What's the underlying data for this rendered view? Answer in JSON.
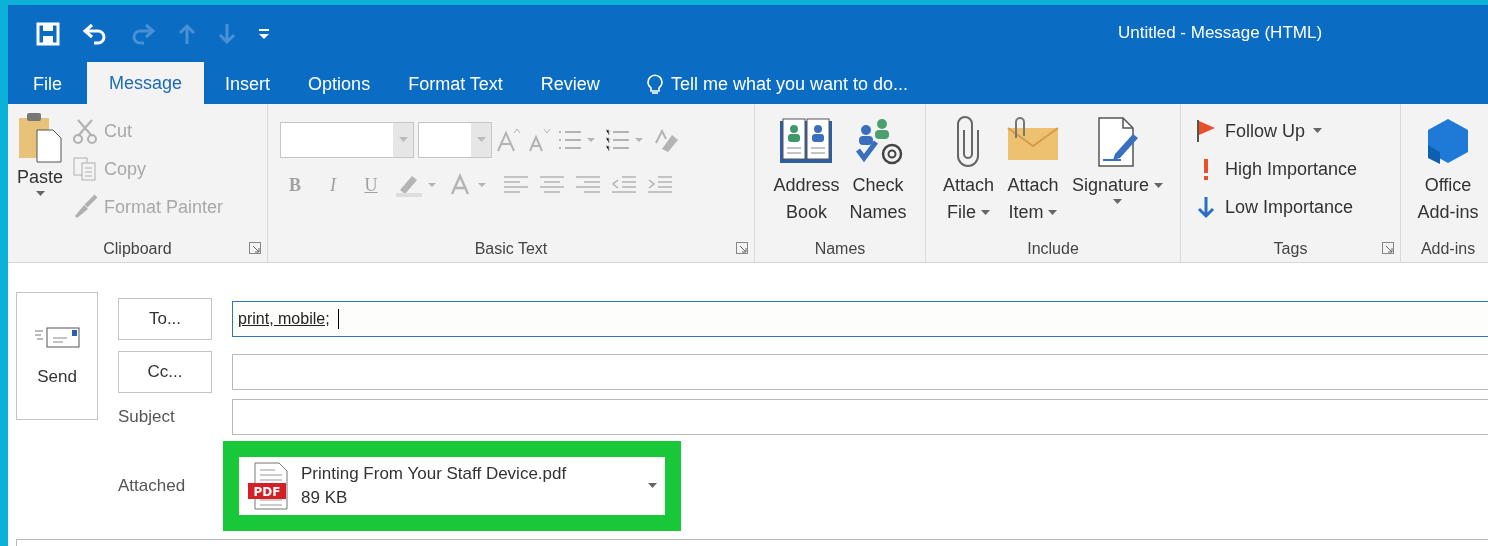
{
  "window": {
    "title": "Untitled - Message (HTML)"
  },
  "quick_access": [
    {
      "kind": "save",
      "disabled": false
    },
    {
      "kind": "undo",
      "disabled": false
    },
    {
      "kind": "redo",
      "disabled": true
    },
    {
      "kind": "up",
      "disabled": true
    },
    {
      "kind": "down",
      "disabled": true
    },
    {
      "kind": "customize",
      "disabled": false
    }
  ],
  "tabs": [
    {
      "label": "File",
      "selected": false
    },
    {
      "label": "Message",
      "selected": true
    },
    {
      "label": "Insert",
      "selected": false
    },
    {
      "label": "Options",
      "selected": false
    },
    {
      "label": "Format Text",
      "selected": false
    },
    {
      "label": "Review",
      "selected": false
    }
  ],
  "tell_me": "Tell me what you want to do...",
  "ribbon": {
    "clipboard": {
      "label": "Clipboard",
      "paste": "Paste",
      "items": [
        {
          "kind": "cut",
          "label": "Cut",
          "disabled": true
        },
        {
          "kind": "copy",
          "label": "Copy",
          "disabled": true
        },
        {
          "kind": "painter",
          "label": "Format Painter",
          "disabled": true
        }
      ]
    },
    "basic_text": {
      "label": "Basic Text",
      "disabled": true,
      "style_buttons": [
        "B",
        "I",
        "U"
      ]
    },
    "names": {
      "label": "Names",
      "buttons": [
        {
          "kind": "book",
          "lines": [
            "Address",
            "Book"
          ],
          "dropdown": false
        },
        {
          "kind": "check",
          "lines": [
            "Check",
            "Names"
          ],
          "dropdown": false
        }
      ]
    },
    "include": {
      "label": "Include",
      "buttons": [
        {
          "kind": "clip",
          "lines": [
            "Attach",
            "File"
          ],
          "dropdown": true
        },
        {
          "kind": "envelope",
          "lines": [
            "Attach",
            "Item"
          ],
          "dropdown": true
        },
        {
          "kind": "signature",
          "lines": [
            "Signature"
          ],
          "dropdown": true
        }
      ]
    },
    "tags": {
      "label": "Tags",
      "items": [
        {
          "kind": "flag",
          "label": "Follow Up",
          "dropdown": true
        },
        {
          "kind": "high",
          "label": "High Importance",
          "dropdown": false
        },
        {
          "kind": "low",
          "label": "Low Importance",
          "dropdown": false
        }
      ]
    },
    "addins": {
      "label": "Add-ins",
      "lines": [
        "Office",
        "Add-ins"
      ]
    }
  },
  "form": {
    "send": "Send",
    "to": {
      "button": "To...",
      "value": "print, mobile;",
      "focused": true
    },
    "cc": {
      "button": "Cc..."
    },
    "subject": {
      "label": "Subject"
    },
    "attached": {
      "label": "Attached",
      "files": [
        {
          "type_label": "PDF",
          "name": "Printing From Your Staff Device.pdf",
          "size": "89 KB",
          "highlighted": true
        }
      ]
    }
  }
}
